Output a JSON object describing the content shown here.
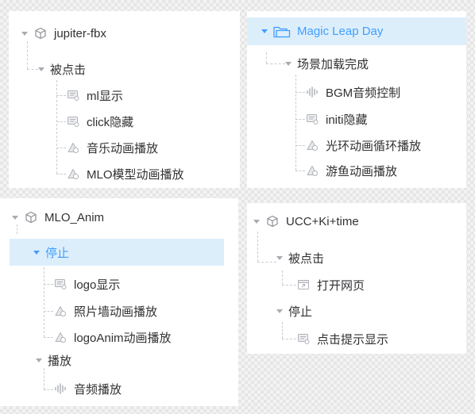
{
  "panels": {
    "jupiter": {
      "root": "jupiter-fbx",
      "group": "被点击",
      "items": [
        "ml显示",
        "click隐藏",
        "音乐动画播放",
        "MLO模型动画播放"
      ]
    },
    "magic": {
      "root": "Magic Leap Day",
      "group": "场景加载完成",
      "items": [
        "BGM音频控制",
        "initi隐藏",
        "光环动画循环播放",
        "游鱼动画播放"
      ]
    },
    "mlo": {
      "root": "MLO_Anim",
      "group1": "停止",
      "group1_items": [
        "logo显示",
        "照片墙动画播放",
        "logoAnim动画播放"
      ],
      "group2": "播放",
      "group2_items": [
        "音频播放"
      ]
    },
    "ucc": {
      "root": "UCC+Ki+time",
      "group1": "被点击",
      "group1_items": [
        "打开网页"
      ],
      "group2": "停止",
      "group2_items": [
        "点击提示显示"
      ]
    }
  },
  "colors": {
    "accent": "#409eff",
    "highlight_bg": "#ddeefb",
    "text": "#303133",
    "icon": "#b1b3b8",
    "guide": "#c9ccd2"
  }
}
